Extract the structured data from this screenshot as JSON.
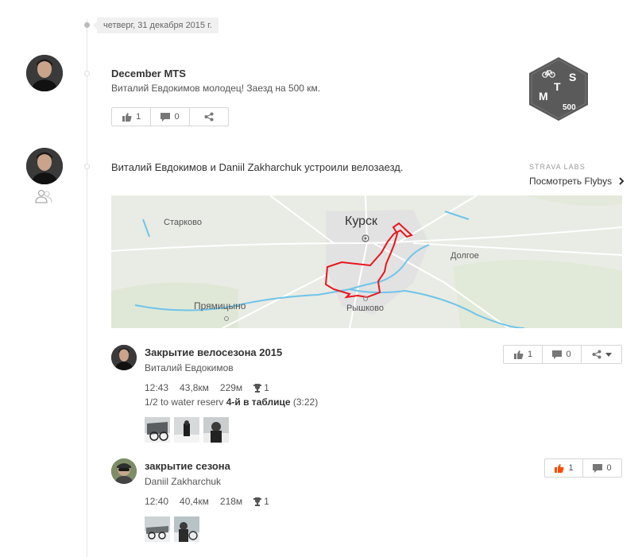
{
  "date_tag": "четверг, 31 декабря 2015 г.",
  "challenge": {
    "title": "December MTS",
    "subtitle": "Виталий Евдокимов молодец! Заезд на 500 км.",
    "kudos_count": "1",
    "comments_count": "0",
    "badge": {
      "letters": [
        "M",
        "T",
        "S"
      ],
      "number": "500",
      "color": "#555555"
    }
  },
  "group_ride": {
    "text": "Виталий Евдокимов и Daniil Zakharchuk устроили велозаезд.",
    "labs_label": "STRAVA LABS",
    "flyby_link": "Посмотреть Flybys",
    "map_labels": {
      "city": "Курск",
      "starkovo": "Старково",
      "dolgoe": "Долгое",
      "pryamitsyno": "Прямицыно",
      "ryshkovo": "Рышково"
    },
    "route_color": "#e8151b"
  },
  "activities": [
    {
      "title": "Закрытие велосезона 2015",
      "athlete": "Виталий Евдокимов",
      "time": "12:43",
      "distance": "43,8км",
      "elevation": "229м",
      "achievements": "1",
      "segment_prefix": "1/2 to water reserv",
      "segment_rank": "4-й в таблице",
      "segment_time": "(3:22)",
      "kudos_count": "1",
      "comments_count": "0"
    },
    {
      "title": "закрытие сезона",
      "athlete": "Daniil Zakharchuk",
      "time": "12:40",
      "distance": "40,4км",
      "elevation": "218м",
      "achievements": "1",
      "kudos_count": "1",
      "comments_count": "0"
    }
  ],
  "colors": {
    "kudos_active": "#fc4c02",
    "accent": "#333333"
  }
}
